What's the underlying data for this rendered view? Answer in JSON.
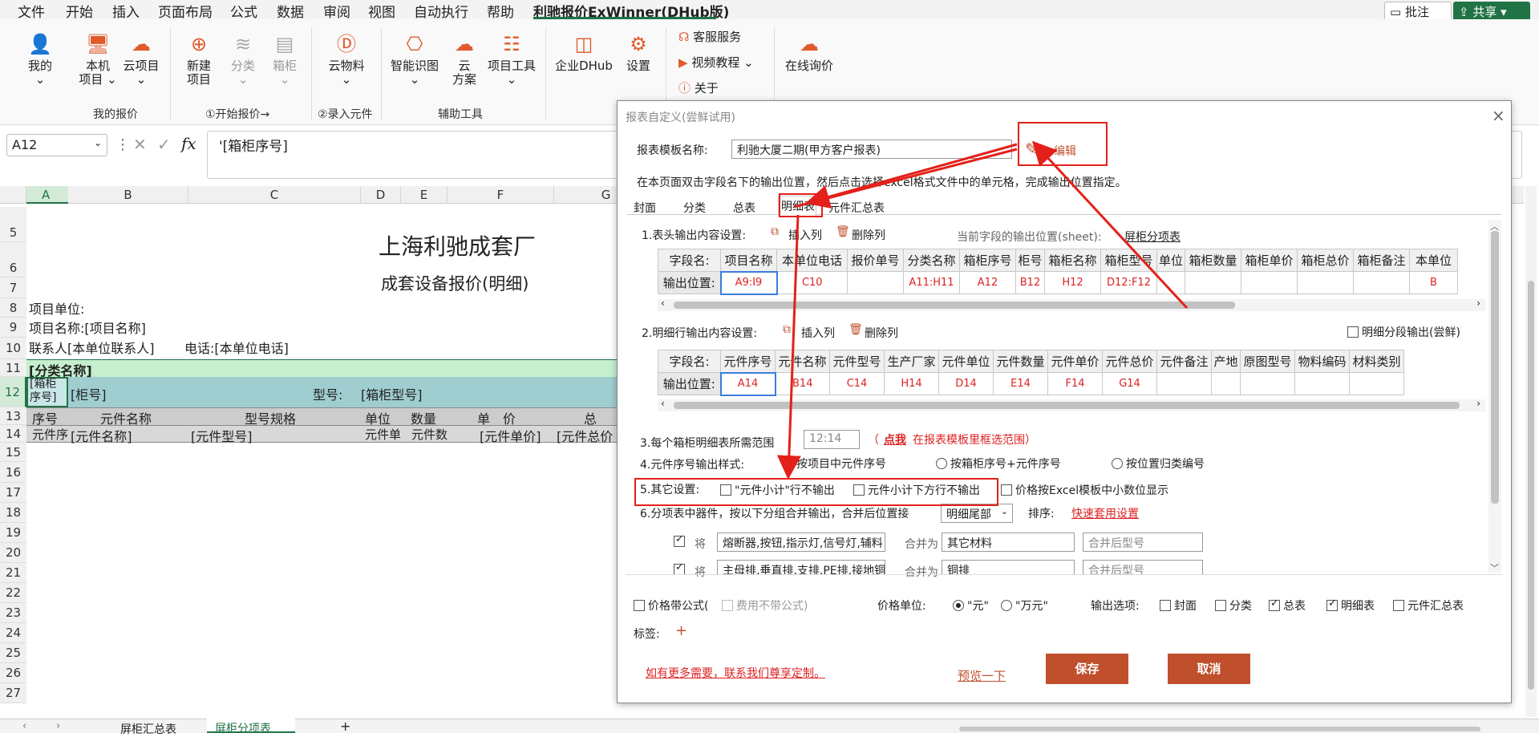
{
  "menu": {
    "items": [
      "文件",
      "开始",
      "插入",
      "页面布局",
      "公式",
      "数据",
      "审阅",
      "视图",
      "自动执行",
      "帮助",
      "利驰报价ExWinner(DHub版)"
    ],
    "comment_btn": "批注",
    "share_btn": "共享"
  },
  "ribbon": {
    "my": "我的",
    "local_project": "本机\n项目",
    "cloud_project": "云项目",
    "new_project": "新建\n项目",
    "category": "分类",
    "cabinet": "箱柜",
    "cloud_material": "云物料",
    "smart_map": "智能识图",
    "cloud_plan": "云\n方案",
    "project_tools": "项目工具",
    "enterprise": "企业DHub",
    "settings": "设置",
    "customer_service": "客服服务",
    "video_tutorial": "视频教程",
    "about": "关于",
    "online_inquiry": "在线询价",
    "group_my_quote": "我的报价",
    "group_start": "①开始报价→",
    "group_enter": "②录入元件",
    "group_aux": "辅助工具"
  },
  "formula": {
    "namebox": "A12",
    "content": "'[箱柜序号]"
  },
  "sheet": {
    "columns": [
      "A",
      "B",
      "C",
      "D",
      "E",
      "F",
      "G"
    ],
    "rows": [
      "5",
      "6",
      "7",
      "8",
      "9",
      "10",
      "11",
      "12",
      "13",
      "14",
      "15",
      "16",
      "17",
      "18",
      "19",
      "20",
      "21",
      "22",
      "23",
      "24",
      "25",
      "26",
      "27"
    ],
    "title": "上海利驰成套厂",
    "subtitle": "成套设备报价(明细)",
    "project_unit": "项目单位:",
    "project_name": "项目名称:[项目名称]",
    "contact": "联系人[本单位联系人]",
    "phone": "电话:[本单位电话]",
    "category_name": "[分类名称]",
    "cab_seq": "[箱柜\n序号]",
    "cab_no": "[柜号]",
    "model_label": "型号:",
    "cab_model": "[箱柜型号]",
    "hdr_seq": "序号",
    "hdr_name": "元件名称",
    "hdr_spec": "型号规格",
    "hdr_unit": "单位",
    "hdr_qty": "数量",
    "hdr_price": "单　价",
    "hdr_total": "总",
    "r14_seq": "元件序号",
    "r14_name": "[元件名称]",
    "r14_model": "[元件型号]",
    "r14_unit": "元件单位",
    "r14_qty": "元件数量",
    "r14_price": "[元件单价]",
    "r14_total": "[元件总价"
  },
  "tabs_bottom": {
    "tab1": "屏柜汇总表",
    "tab2": "屏柜分项表",
    "add": "+"
  },
  "dialog": {
    "title": "报表自定义(尝鲜试用)",
    "template_label": "报表模板名称:",
    "template_value": "利驰大厦二期(甲方客户报表)",
    "edit": "编辑",
    "hint": "在本页面双击字段名下的输出位置，然后点击选择excel格式文件中的单元格，完成输出位置指定。",
    "tabs": [
      "封面",
      "分类",
      "总表",
      "明细表",
      "元件汇总表"
    ],
    "sec1_title": "1.表头输出内容设置:",
    "insert_col": "插入列",
    "delete_col": "删除列",
    "current_sheet_label": "当前字段的输出位置(sheet):",
    "current_sheet": "屏柜分项表",
    "field_label": "字段名:",
    "output_label": "输出位置:",
    "head_fields": [
      "项目名称",
      "本单位电话",
      "报价单号",
      "分类名称",
      "箱柜序号",
      "柜号",
      "箱柜名称",
      "箱柜型号",
      "单位",
      "箱柜数量",
      "箱柜单价",
      "箱柜总价",
      "箱柜备注",
      "本单位"
    ],
    "head_positions": [
      "A9:I9",
      "C10",
      "",
      "A11:H11",
      "A12",
      "B12",
      "H12",
      "D12:F12",
      "",
      "",
      "",
      "",
      "",
      "B"
    ],
    "sec2_title": "2.明细行输出内容设置:",
    "segment_output": "明细分段输出(尝鲜)",
    "detail_fields": [
      "元件序号",
      "元件名称",
      "元件型号",
      "生产厂家",
      "元件单位",
      "元件数量",
      "元件单价",
      "元件总价",
      "元件备注",
      "产地",
      "原图型号",
      "物料编码",
      "材料类别"
    ],
    "detail_positions": [
      "A14",
      "B14",
      "C14",
      "H14",
      "D14",
      "E14",
      "F14",
      "G14",
      "",
      "",
      "",
      "",
      ""
    ],
    "sec3_label": "3.每个箱柜明细表所需范围",
    "sec3_value": "12:14",
    "sec3_link": "点我",
    "sec3_tail": "在报表模板里框选范围）",
    "sec4_label": "4.元件序号输出样式:",
    "sec4_opts": [
      "按项目中元件序号",
      "按箱柜序号+元件序号",
      "按位置归类编号"
    ],
    "sec5_label": "5.其它设置:",
    "sec5_opts": [
      "\"元件小计\"行不输出",
      "元件小计下方行不输出",
      "价格按Excel模板中小数位显示"
    ],
    "sec6_label": "6.分项表中器件，按以下分组合并输出，合并后位置接",
    "sec6_pos": "明细尾部",
    "sort_label": "排序:",
    "quick_set": "快速套用设置",
    "merge_prefix": "将",
    "merge_as": "合并为",
    "merge1_src": "熔断器,按钮,指示灯,信号灯,辅料",
    "merge1_dst": "其它材料",
    "merge1_model": "合并后型号",
    "merge2_src": "主母排,垂直排,支排,PE排,接地铜排",
    "merge2_dst": "铜排",
    "merge2_model": "合并后型号",
    "price_formula": "价格带公式(",
    "fee_no_formula": "费用不带公式)",
    "price_unit_label": "价格单位:",
    "unit_yuan": "\"元\"",
    "unit_wanyuan": "\"万元\"",
    "output_opts_label": "输出选项:",
    "output_opts": [
      "封面",
      "分类",
      "总表",
      "明细表",
      "元件汇总表"
    ],
    "tag_label": "标签:",
    "tag_add": "+",
    "custom_link": "如有更多需要，联系我们尊享定制。",
    "preview": "预览一下",
    "save": "保存",
    "cancel": "取消"
  },
  "colors": {
    "accent_green": "#217346",
    "red_mark": "#e3211a",
    "button": "#c0502d",
    "category_row": "#c6efce",
    "cabinet_row": "#9fcdd0"
  }
}
